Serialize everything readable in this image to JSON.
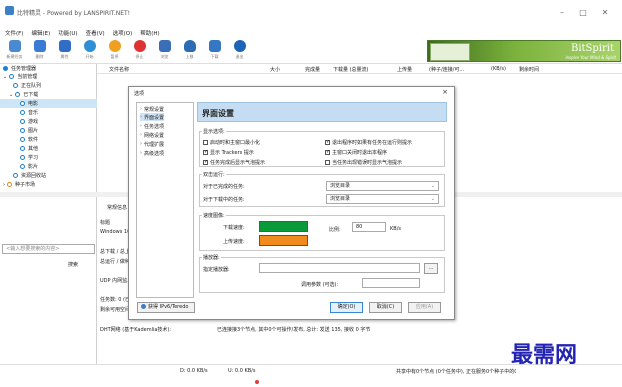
{
  "app": {
    "title": "比特精灵 - Powered by LANSPIRIT.NET!",
    "window_buttons": [
      "–",
      "□",
      "✕"
    ]
  },
  "menu": [
    "文件(F)",
    "编辑(E)",
    "功能(U)",
    "查看(V)",
    "选项(O)",
    "帮助(H)"
  ],
  "toolbar": [
    {
      "label": "新建任务",
      "color": "#4a8ad0"
    },
    {
      "label": "删除",
      "color": "#3c7bd3"
    },
    {
      "label": "属性",
      "color": "#2f6dc7"
    },
    {
      "label": "开始",
      "color": "#2e8fd6"
    },
    {
      "label": "暂停",
      "color": "#f0a020"
    },
    {
      "label": "停止",
      "color": "#d33"
    },
    {
      "label": "浏览",
      "color": "#3a6fb8"
    },
    {
      "label": "上移",
      "color": "#2d6bb3"
    },
    {
      "label": "下载",
      "color": "#3577c2"
    },
    {
      "label": "退出",
      "color": "#1c64b6"
    }
  ],
  "brand": {
    "name": "BitSpirit",
    "slogan": "Inspire Your Mind & Spirit"
  },
  "sidebar": {
    "items": [
      "任务管理器",
      "当前管理",
      "正在队列",
      "已下载",
      "电影",
      "音乐",
      "游戏",
      "图片",
      "软件",
      "其他",
      "学习",
      "影片",
      "资源回收站",
      "种子市场"
    ]
  },
  "list_header": {
    "cols": [
      "文件名称",
      "大小",
      "完成量",
      "下载量 (总量流)",
      "上传量",
      "(种子/连接/可...",
      "(KB/s)",
      "剩余时间"
    ]
  },
  "main_fragments": [
    "常规信息",
    "标题",
    "Windows 10",
    "总下载 / 总上传",
    "总运行 / 做种",
    "UDP 内网监...",
    "任务数: 0 (已...",
    "剩余可用空间...",
    "<输入想要搜索的内容>",
    "搜索",
    "DHT网络 (基于Kademlia技术):",
    "已连接接3个节点, 其中0个可操作/发布, 总计: 发送 135, 接收 0 字节",
    "D: 0.0 KB/s",
    "U: 0.0 KB/s",
    "共享中有0个节点 (0个任务中), 正在服务0个种子中的0个种子"
  ],
  "dialog": {
    "title": "选项",
    "close": "×",
    "nav": [
      "常规设置",
      "界面设置",
      "任务选项",
      "网络设置",
      "代理扩展",
      "高级选项"
    ],
    "page_title": "界面设置",
    "display_label": "显示选项:",
    "checks": [
      {
        "label": "启动时和主窗口最小化",
        "on": false
      },
      {
        "label": "退出程序时如果有任务在运行则提示",
        "on": true
      },
      {
        "label": "显示 Trackers 提示",
        "on": true
      },
      {
        "label": "主窗口关闭时退出本程序",
        "on": true
      },
      {
        "label": "任务完成后显示气泡提示",
        "on": true
      },
      {
        "label": "当任务出现错误时显示气泡提示",
        "on": false
      }
    ],
    "double_click_label": "双击运行:",
    "dbl_done_label": "对于已完成的任务:",
    "dbl_done_value": "浏览目录",
    "dbl_running_label": "对于下载中的任务:",
    "dbl_running_value": "浏览目录",
    "color_label": "速度图像:",
    "dl_color_label": "下载速度:",
    "ul_color_label": "上传速度:",
    "dl_color": "#0a9a3a",
    "ul_color": "#f08c1e",
    "scale_label": "比例:",
    "scale_value": "80",
    "scale_unit": "KB/s",
    "player_label": "播放器:",
    "player_path_label": "指定播放器:",
    "player_path": "",
    "browse": "...",
    "params_label": "调用参数 (可选):",
    "params_value": "",
    "ipv6_label": "获得 IPv6/Teredo",
    "ok": "确定(O)",
    "cancel": "取消(C)",
    "apply": "应用(A)"
  },
  "watermark": "最需网"
}
